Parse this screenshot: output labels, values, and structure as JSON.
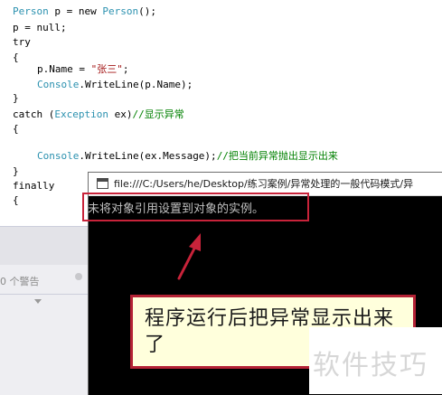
{
  "editor": {
    "lines": [
      "Person p = new Person();",
      "p = null;",
      "try",
      "{",
      "p.Name = \"张三\";",
      "Console.WriteLine(p.Name);",
      "}",
      "catch (Exception ex)//显示异常",
      "{",
      "",
      "Console.WriteLine(ex.Message);//把当前异常抛出显示出来",
      "}",
      "finally",
      "{"
    ]
  },
  "ide_panel": {
    "warnings_label": "0 个警告"
  },
  "console_window": {
    "title": "file:///C:/Users/he/Desktop/练习案例/异常处理的一般代码模式/异",
    "output": "未将对象引用设置到对象的实例。"
  },
  "callout": {
    "text": "程序运行后把异常显示出来了"
  },
  "watermark": {
    "text": "软件技巧"
  },
  "colors": {
    "annotation_red": "#c8233a",
    "callout_bg": "#ffffdc",
    "type_blue": "#2b91af",
    "string_red": "#a31515",
    "comment_green": "#008000"
  }
}
